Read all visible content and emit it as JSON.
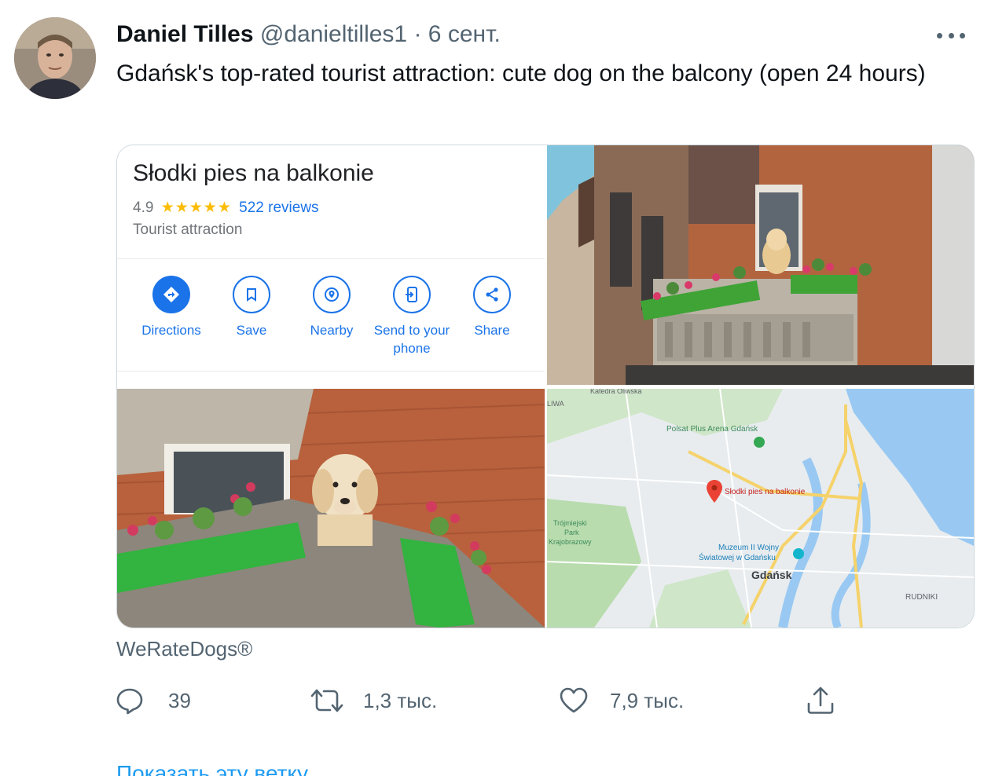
{
  "author": {
    "name": "Daniel Tilles",
    "handle": "@danieltilles1",
    "separator": "·",
    "date": "6 сент."
  },
  "tweet": {
    "text": "Gdańsk's top-rated tourist attraction: cute dog on the balcony (open 24 hours)"
  },
  "card": {
    "place_name": "Słodki pies na balkonie",
    "rating": "4.9",
    "stars": "★★★★★",
    "reviews": "522 reviews",
    "category": "Tourist attraction",
    "actions": [
      {
        "label": "Directions",
        "icon": "directions-icon"
      },
      {
        "label": "Save",
        "icon": "bookmark-icon"
      },
      {
        "label": "Nearby",
        "icon": "nearby-icon"
      },
      {
        "label": "Send to your phone",
        "icon": "send-to-phone-icon"
      },
      {
        "label": "Share",
        "icon": "share-icon"
      }
    ],
    "map": {
      "marker_label": "Słodki pies na balkonie",
      "labels": {
        "city": "Gdańsk",
        "arena": "Polsat Plus Arena Gdańsk",
        "museum_line1": "Muzeum II Wojny",
        "museum_line2": "Światowej w Gdańsku",
        "district_rudniki": "RUDNIKI",
        "park_line1": "Trójmiejski",
        "park_line2": "Park",
        "park_line3": "Krajobrazowy",
        "cathedral": "Katedra Oliwska",
        "corner": "LIWA"
      }
    }
  },
  "source": "WeRateDogs®",
  "stats": {
    "replies": "39",
    "retweets": "1,3 тыс.",
    "likes": "7,9 тыс."
  },
  "show_thread": "Показать эту ветку",
  "colors": {
    "accent_blue": "#1a73e8",
    "twitter_blue": "#1d9bf0",
    "star_yellow": "#fbbc04",
    "muted_text": "#536471",
    "marker_red": "#ea4335"
  }
}
